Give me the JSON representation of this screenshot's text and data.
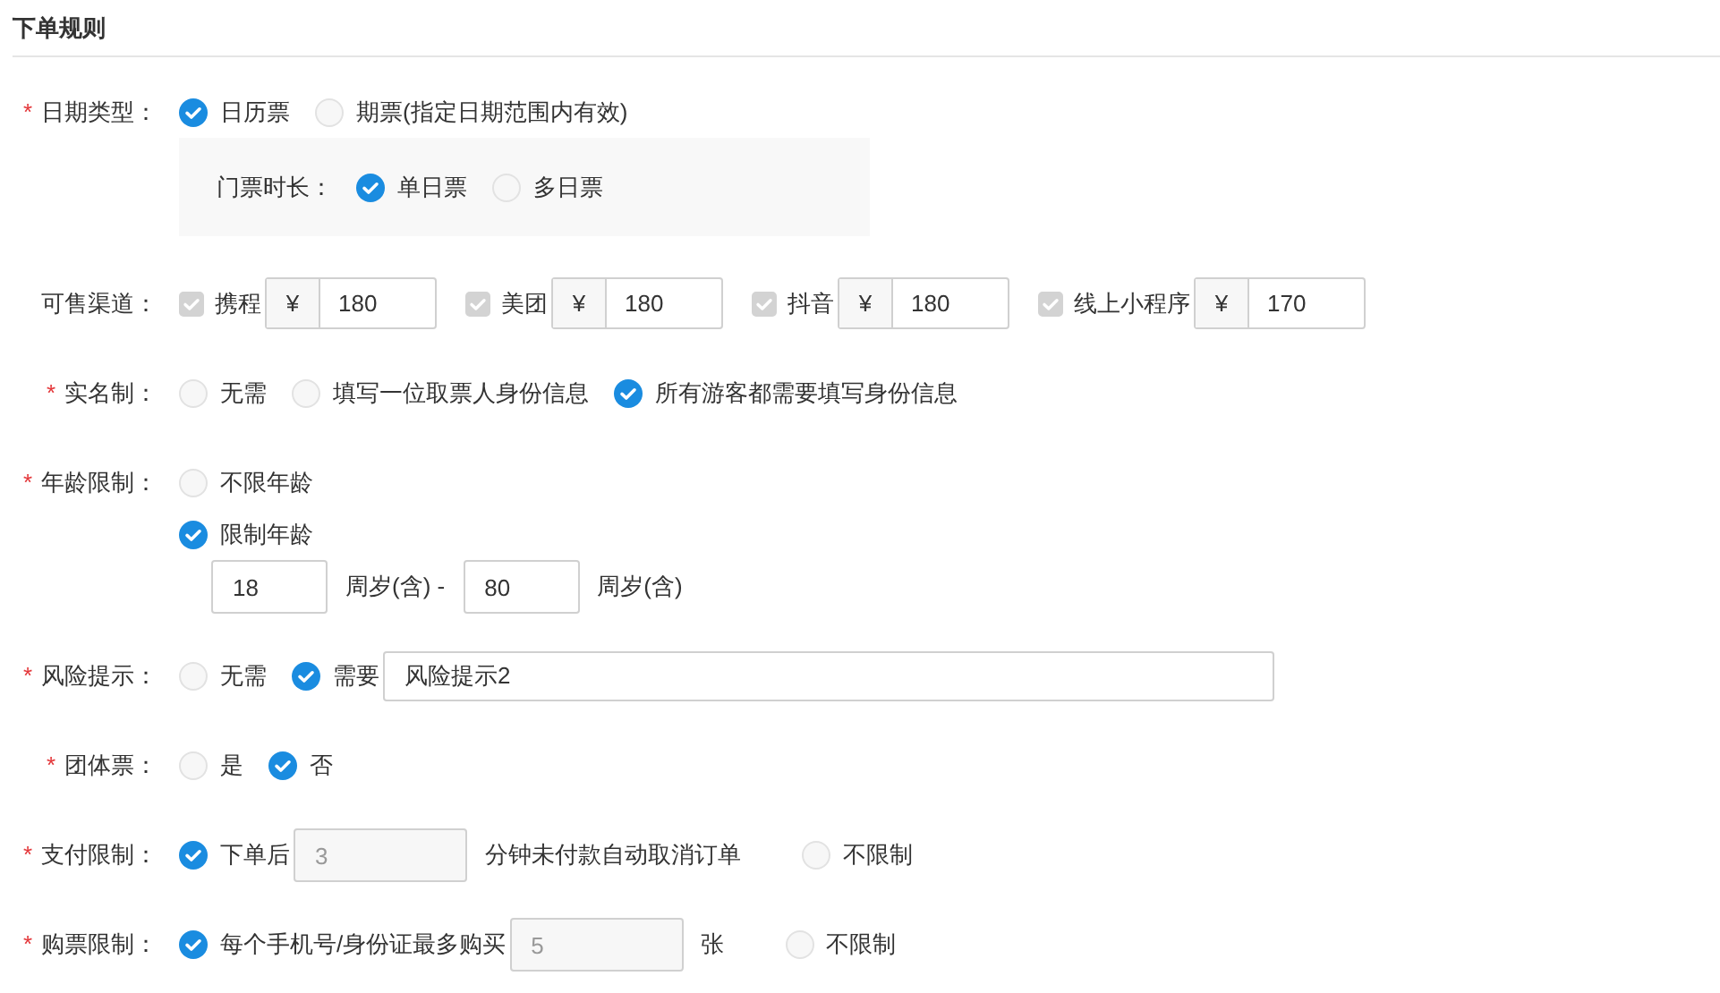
{
  "section_title": "下单规则",
  "rows": [
    {
      "label": "日期类型：",
      "required_mark": "*",
      "lines": [
        [
          {
            "kind": "radio",
            "label": "日历票",
            "selected": true
          },
          {
            "kind": "radio",
            "label": "期票(指定日期范围内有效)",
            "selected": false
          }
        ],
        [
          {
            "kind": "panel",
            "label": "门票时长：",
            "options": [
              {
                "label": "单日票",
                "selected": true
              },
              {
                "label": "多日票",
                "selected": false
              }
            ]
          }
        ]
      ]
    },
    {
      "label": "可售渠道：",
      "lines": [
        [
          {
            "kind": "channel",
            "label": "携程",
            "checked": true,
            "disabled": true,
            "currency": "¥",
            "value": "180"
          },
          {
            "kind": "channel",
            "label": "美团",
            "checked": true,
            "disabled": true,
            "currency": "¥",
            "value": "180"
          },
          {
            "kind": "channel",
            "label": "抖音",
            "checked": true,
            "disabled": true,
            "currency": "¥",
            "value": "180"
          },
          {
            "kind": "channel",
            "label": "线上小程序",
            "checked": true,
            "disabled": true,
            "currency": "¥",
            "value": "170"
          }
        ]
      ]
    },
    {
      "label": "实名制：",
      "required_mark": "*",
      "lines": [
        [
          {
            "kind": "radio",
            "label": "无需",
            "selected": false
          },
          {
            "kind": "radio",
            "label": "填写一位取票人身份信息",
            "selected": false
          },
          {
            "kind": "radio",
            "label": "所有游客都需要填写身份信息",
            "selected": true
          }
        ]
      ]
    },
    {
      "label": "年龄限制：",
      "required_mark": "*",
      "lines": [
        [
          {
            "kind": "radio",
            "label": "不限年龄",
            "selected": false
          }
        ],
        [
          {
            "kind": "radio",
            "label": "限制年龄",
            "selected": true
          }
        ],
        [
          {
            "kind": "age-input",
            "value": "18",
            "disabled": false
          },
          {
            "kind": "text",
            "label": "周岁(含) -"
          },
          {
            "kind": "age-input",
            "value": "80",
            "disabled": false
          },
          {
            "kind": "text",
            "label": "周岁(含)"
          }
        ]
      ]
    },
    {
      "label": "风险提示：",
      "required_mark": "*",
      "lines": [
        [
          {
            "kind": "radio",
            "label": "无需",
            "selected": false
          },
          {
            "kind": "radio",
            "label": "需要",
            "selected": true
          },
          {
            "kind": "text-input",
            "value": "风险提示2",
            "disabled": false
          }
        ]
      ]
    },
    {
      "label": "团体票：",
      "required_mark": "*",
      "lines": [
        [
          {
            "kind": "radio",
            "label": "是",
            "selected": false
          },
          {
            "kind": "radio",
            "label": "否",
            "selected": true
          }
        ]
      ]
    },
    {
      "label": "支付限制：",
      "required_mark": "*",
      "lines": [
        [
          {
            "kind": "radio",
            "label": "下单后",
            "selected": true
          },
          {
            "kind": "count-input",
            "value": "3",
            "disabled": true
          },
          {
            "kind": "text",
            "label": "分钟未付款自动取消订单"
          },
          {
            "kind": "radio",
            "label": "不限制",
            "selected": false
          }
        ]
      ]
    },
    {
      "label": "购票限制：",
      "required_mark": "*",
      "lines": [
        [
          {
            "kind": "radio",
            "label": "每个手机号/身份证最多购买",
            "selected": true
          },
          {
            "kind": "count-input",
            "value": "5",
            "disabled": true
          },
          {
            "kind": "text",
            "label": "张"
          },
          {
            "kind": "radio",
            "label": "不限制",
            "selected": false
          }
        ]
      ]
    }
  ]
}
